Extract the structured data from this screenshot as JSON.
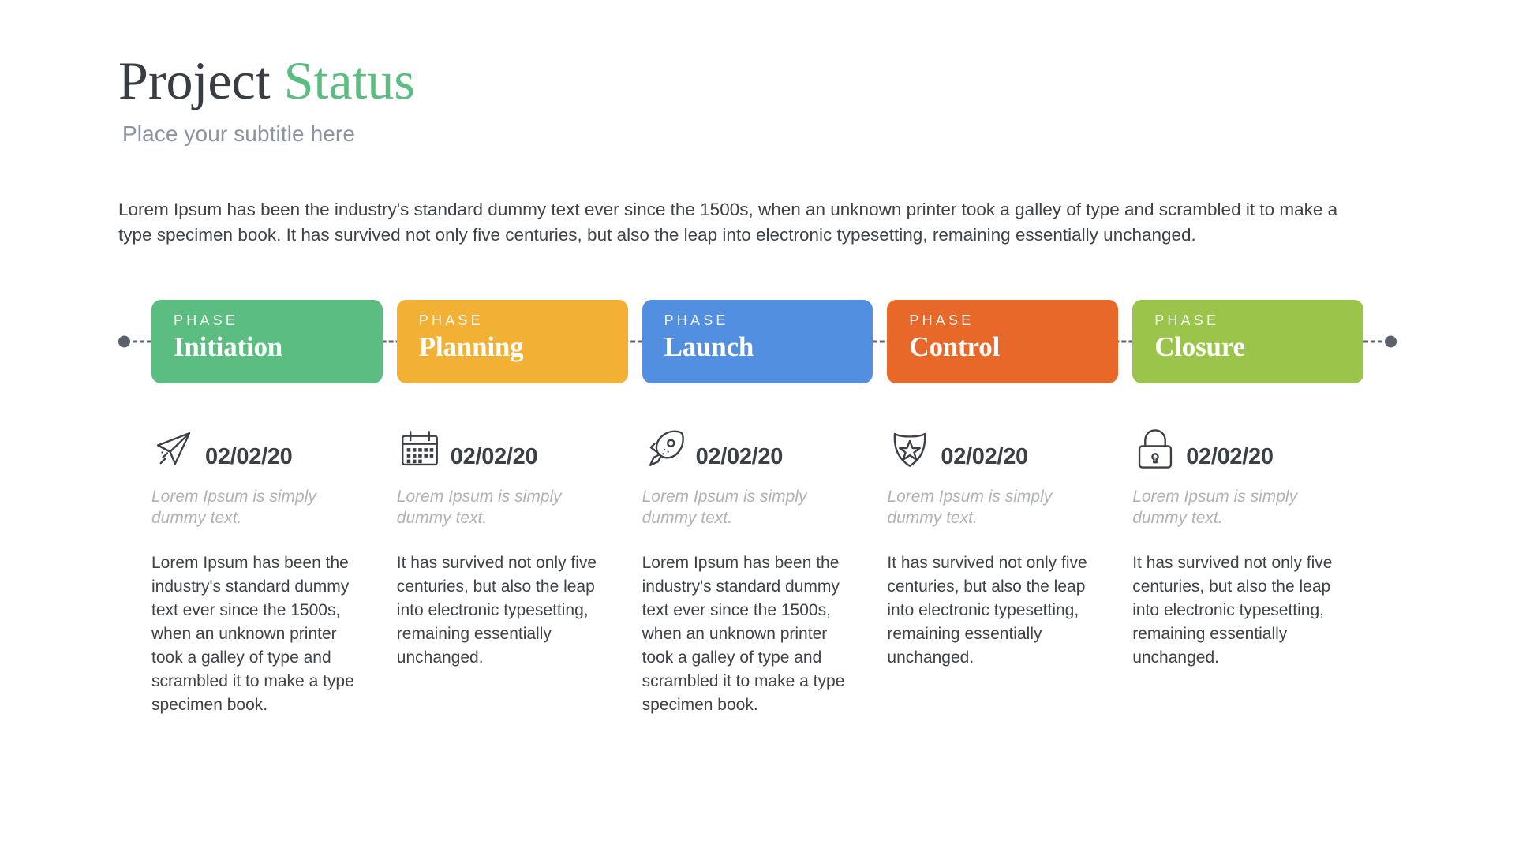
{
  "header": {
    "title_main": "Project",
    "title_accent": "Status",
    "subtitle": "Place your subtitle here"
  },
  "intro": "Lorem Ipsum has been the industry's standard dummy text ever since the 1500s, when an unknown printer took a galley of type and scrambled it to make a type specimen book. It has survived not only five centuries, but also the leap into electronic typesetting, remaining essentially unchanged.",
  "timeline": {
    "rail_color": "#5b626b",
    "phase_kicker": "PHASE",
    "phases": [
      {
        "kicker": "PHASE",
        "name": "Initiation",
        "color": "#5cbd80"
      },
      {
        "kicker": "PHASE",
        "name": "Planning",
        "color": "#f2b134"
      },
      {
        "kicker": "PHASE",
        "name": "Launch",
        "color": "#528fe0"
      },
      {
        "kicker": "PHASE",
        "name": "Control",
        "color": "#e8682a"
      },
      {
        "kicker": "PHASE",
        "name": "Closure",
        "color": "#9ac44a"
      }
    ]
  },
  "columns": [
    {
      "icon": "paper-plane-icon",
      "date": "02/02/20",
      "lead": "Lorem Ipsum is simply dummy text.",
      "body": "Lorem Ipsum has been the industry's standard dummy text ever since the 1500s, when an unknown printer took a galley of type and scrambled it to make a type specimen book."
    },
    {
      "icon": "calendar-icon",
      "date": "02/02/20",
      "lead": "Lorem Ipsum is simply dummy text.",
      "body": "It has survived not only five centuries, but also the leap into electronic typesetting, remaining essentially unchanged."
    },
    {
      "icon": "rocket-icon",
      "date": "02/02/20",
      "lead": "Lorem Ipsum is simply dummy text.",
      "body": "Lorem Ipsum has been the industry's standard dummy text ever since the 1500s, when an unknown printer took a galley of type and scrambled it to make a type specimen book."
    },
    {
      "icon": "shield-star-icon",
      "date": "02/02/20",
      "lead": "Lorem Ipsum is simply dummy text.",
      "body": "It has survived not only five centuries, but also the leap into electronic typesetting, remaining essentially unchanged."
    },
    {
      "icon": "lock-icon",
      "date": "02/02/20",
      "lead": "Lorem Ipsum is simply dummy text.",
      "body": "It has survived not only five centuries, but also the leap into electronic typesetting, remaining essentially unchanged."
    }
  ]
}
